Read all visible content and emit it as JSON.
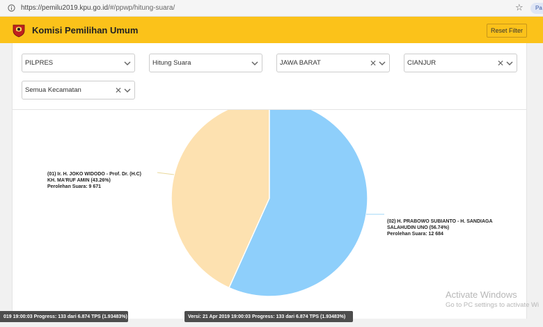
{
  "browser": {
    "url_host": "https://pemilu2019.kpu.go.id",
    "url_path": "/#/ppwp/hitung-suara/",
    "profile_badge": "Pa"
  },
  "header": {
    "title": "Komisi Pemilihan Umum",
    "reset_label": "Reset Filter"
  },
  "filters": {
    "election": "PILPRES",
    "mode": "Hitung Suara",
    "province": "JAWA BARAT",
    "regency": "CIANJUR",
    "district": "Semua Kecamatan"
  },
  "chart_data": {
    "type": "pie",
    "slices": [
      {
        "label_line1": "(01) Ir. H. JOKO WIDODO - Prof. Dr. (H.C)",
        "label_line2": "KH. MA'RUF AMIN (43.26%)",
        "label_line3": "Perolehan Suara: 9 671",
        "value": 9671,
        "percent": 43.26,
        "color": "#fde1b0"
      },
      {
        "label_line1": "(02) H. PRABOWO SUBIANTO - H. SANDIAGA",
        "label_line2": "SALAHUDIN UNO (56.74%)",
        "label_line3": "Perolehan Suara: 12 684",
        "value": 12684,
        "percent": 56.74,
        "color": "#8ecffb"
      }
    ]
  },
  "footer": {
    "version_left": "019 19:00:03 Progress: 133 dari 6.874 TPS (1.93483%)",
    "version_center": "Versi: 21 Apr 2019 19:00:03 Progress: 133 dari 6.874 TPS (1.93483%)"
  },
  "watermark": {
    "line1": "Activate Windows",
    "line2": "Go to PC settings to activate Wi"
  }
}
